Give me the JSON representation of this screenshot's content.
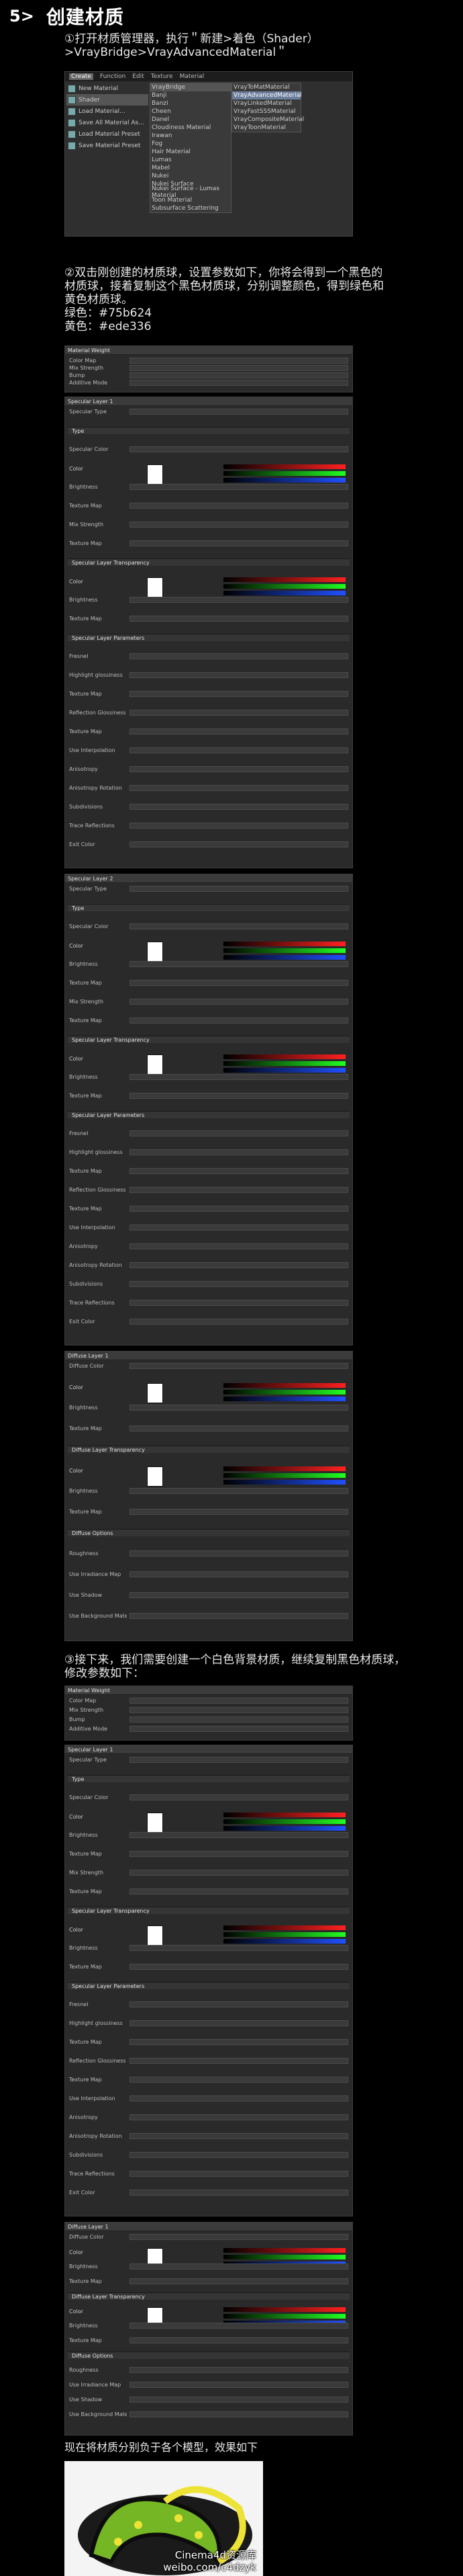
{
  "header": {
    "step_number": "5>",
    "title": "创建材质"
  },
  "step1": {
    "text": "①打开材质管理器，执行＂新建>着色（Shader）>VrayBridge>VrayAdvancedMaterial＂"
  },
  "menu": {
    "menubar": [
      "Create",
      "Function",
      "Edit",
      "Texture",
      "Material"
    ],
    "left_items": [
      "New Material",
      "Shader",
      "Load Material...",
      "Save All Material As...",
      "Load Material Preset",
      "Save Material Preset"
    ],
    "shader_items": [
      "VrayBridge",
      "Banji",
      "Banzi",
      "Cheen",
      "Danel",
      "Cloudiness Material",
      "Irawan",
      "Fog",
      "Hair Material",
      "Lumas",
      "Mabel",
      "Nukei",
      "Nukei Surface",
      "Nukei Surface - Lumas Material",
      "Toon Material",
      "Subsurface Scattering"
    ],
    "vray_items": [
      "VrayToMatMaterial",
      "VrayAdvancedMaterial",
      "VrayLinkedMaterial",
      "VrayFastSSSMaterial",
      "VrayCompositeMaterial",
      "VrayToonMaterial"
    ]
  },
  "step2": {
    "lines": [
      "②双击刚创建的材质球，设置参数如下，你将会得到一个黑色的",
      "材质球，接着复制这个黑色材质球，分别调整颜色，得到绿色和",
      "黄色材质球。",
      "绿色：#75b624",
      "黄色：#ede336"
    ]
  },
  "panel_labels": {
    "material_weight": "Material Weight",
    "spec1": "Specular Layer 1",
    "spec2": "Specular Layer 2",
    "diffuse1": "Diffuse Layer 1",
    "rows_weight": [
      "Color Map",
      "Mix Strength",
      "Bump",
      "Additive Mode"
    ],
    "rows_spec": [
      "Specular Type",
      "Type",
      "Specular Color",
      "Color",
      "Brightness",
      "Texture Map",
      "Mix Strength",
      "Texture Map",
      "Specular Layer Transparency",
      "Color",
      "Brightness",
      "Texture Map",
      "Specular Layer Parameters",
      "Fresnel",
      "Highlight glossiness",
      "Texture Map",
      "Reflection Glossiness",
      "Texture Map",
      "Use Interpolation",
      "Anisotropy",
      "Anisotropy Rotation",
      "Subdivisions",
      "Trace Reflections",
      "Exit Color"
    ],
    "rows_diffuse": [
      "Diffuse Color",
      "Color",
      "Brightness",
      "Texture Map",
      "Diffuse Layer Transparency",
      "Color",
      "Brightness",
      "Texture Map",
      "Diffuse Options",
      "Roughness",
      "Use Irradiance Map",
      "Use Shadow",
      "Use Background Material"
    ]
  },
  "step3": {
    "lines": [
      "③接下来，我们需要创建一个白色背景材质，继续复制黑色材质球，",
      "修改参数如下："
    ]
  },
  "step4": {
    "text": "现在将材质分别负于各个模型，效果如下"
  },
  "watermark": {
    "line1": "Cinema4d资源库",
    "line2": "weibo.com/c4dzyk"
  },
  "colors": {
    "green": "#75b624",
    "yellow": "#ede336"
  }
}
